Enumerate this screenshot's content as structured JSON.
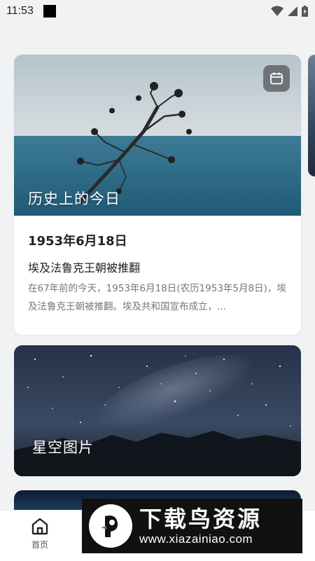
{
  "status_bar": {
    "time": "11:53"
  },
  "history_card": {
    "title": "历史上的今日",
    "date": "1953年6月18日",
    "event": "埃及法鲁克王朝被推翻",
    "description": "在67年前的今天，1953年6月18日(农历1953年5月8日)，埃及法鲁克王朝被推翻。埃及共和国宣布成立，..."
  },
  "starry_card": {
    "title": "星空图片"
  },
  "bottom_nav": {
    "home_label": "首页"
  },
  "watermark": {
    "brand": "下载鸟资源",
    "url": "www.xiazainiao.com"
  },
  "colors": {
    "page_bg": "#f1f2f4",
    "card_bg": "#ffffff",
    "watermark_bg": "#111111"
  }
}
